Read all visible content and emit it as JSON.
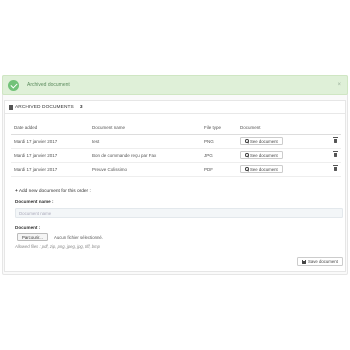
{
  "alert": {
    "message": "Archived document",
    "close": "×"
  },
  "panel": {
    "title": "ARCHIVED DOCUMENTS",
    "count": "3",
    "columns": [
      "Date added",
      "Document name",
      "File type",
      "Document"
    ],
    "rows": [
      {
        "date": "Mardi 17 janvier 2017",
        "name": "test",
        "type": "PNG",
        "action": "See document"
      },
      {
        "date": "Mardi 17 janvier 2017",
        "name": "Bon de commande reçu par Fax",
        "type": "JPG",
        "action": "See document"
      },
      {
        "date": "Mardi 17 janvier 2017",
        "name": "Preuve Colissimo",
        "type": "PDF",
        "action": "See document"
      }
    ]
  },
  "add": {
    "title": "Add new document for this order :",
    "name_label": "Document name :",
    "name_placeholder": "Document name",
    "doc_label": "Document :",
    "browse": "Parcourir...",
    "no_file": "Aucun fichier sélectionné.",
    "allowed": "Allowed files : pdf, zip, png, jpeg, jpg, tiff, bmp",
    "save": "Save document"
  },
  "colors": {
    "alert_bg": "#dff0d8",
    "check": "#72c279"
  }
}
